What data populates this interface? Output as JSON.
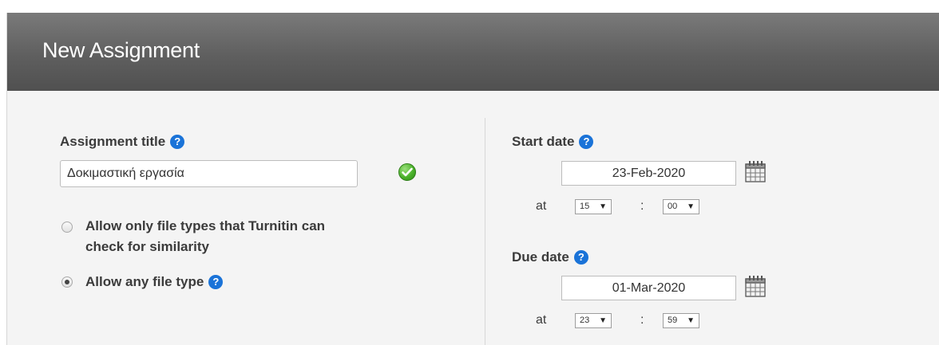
{
  "header": {
    "title": "New Assignment"
  },
  "assignment": {
    "title_label": "Assignment title",
    "title_value": "Δοκιμαστική εργασία",
    "help_glyph": "?",
    "file_options": [
      {
        "label_line1": "Allow only file types that Turnitin can",
        "label_line2": "check for similarity",
        "selected": false
      },
      {
        "label": "Allow any file type",
        "selected": true
      }
    ]
  },
  "start_date": {
    "label": "Start date",
    "date": "23-Feb-2020",
    "at_label": "at",
    "hour": "15",
    "minute": "00"
  },
  "due_date": {
    "label": "Due date",
    "date": "01-Mar-2020",
    "at_label": "at",
    "hour": "23",
    "minute": "59"
  },
  "time_separator": ":",
  "dropdown_arrow": "▼",
  "colors": {
    "header_bg": "#5f5f5f",
    "panel_bg": "#f4f4f4",
    "help_blue": "#1a73d8",
    "valid_green": "#4bb22b"
  },
  "icons": [
    "help-icon",
    "valid-check-icon",
    "calendar-icon"
  ]
}
